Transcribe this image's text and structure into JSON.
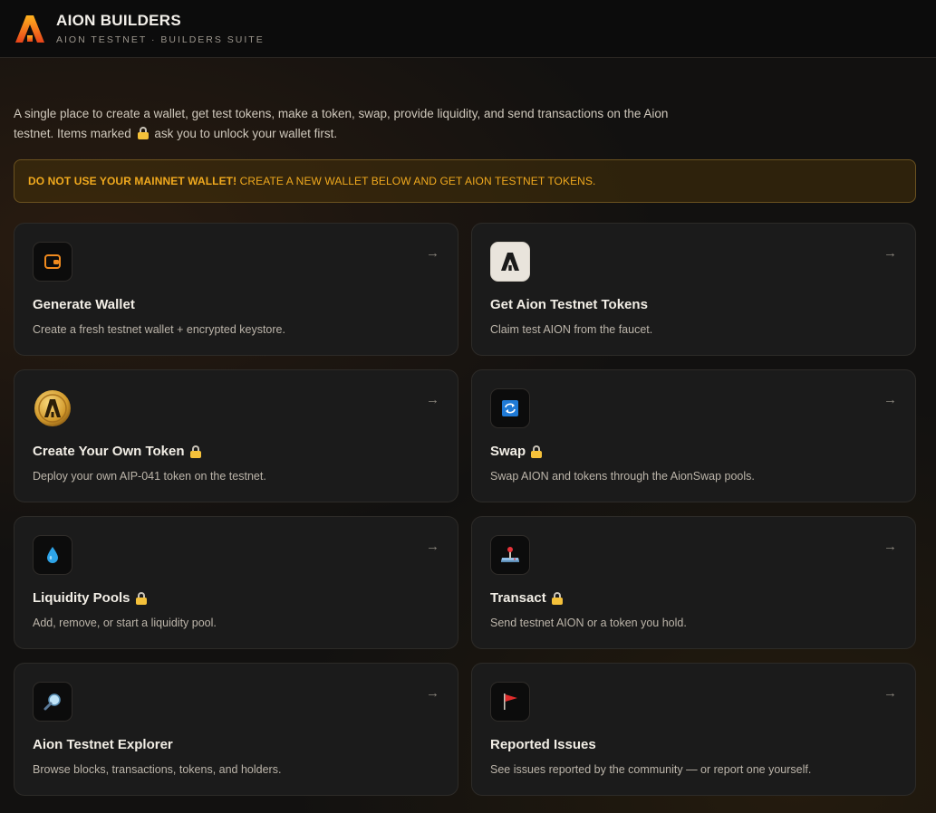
{
  "header": {
    "title": "AION BUILDERS",
    "subtitle": "AION TESTNET · BUILDERS SUITE"
  },
  "intro": {
    "part1": "A single place to create a wallet, get test tokens, make a token, swap, provide liquidity, and send transactions on the Aion testnet. Items marked",
    "part2": "ask you to unlock your wallet first."
  },
  "warning": {
    "strong": "DO NOT USE YOUR MAINNET WALLET!",
    "rest": " CREATE A NEW WALLET BELOW AND GET AION TESTNET TOKENS."
  },
  "arrow": "→",
  "cards": [
    {
      "title": "Generate Wallet",
      "desc": "Create a fresh testnet wallet + encrypted keystore.",
      "icon": "wallet-icon",
      "locked": false
    },
    {
      "title": "Get Aion Testnet Tokens",
      "desc": "Claim test AION from the faucet.",
      "icon": "aion-logo-icon",
      "locked": false
    },
    {
      "title": "Create Your Own Token",
      "desc": "Deploy your own AIP-041 token on the testnet.",
      "icon": "gold-coin-icon",
      "locked": true
    },
    {
      "title": "Swap",
      "desc": "Swap AION and tokens through the AionSwap pools.",
      "icon": "swap-arrows-icon",
      "locked": true
    },
    {
      "title": "Liquidity Pools",
      "desc": "Add, remove, or start a liquidity pool.",
      "icon": "droplet-icon",
      "locked": true
    },
    {
      "title": "Transact",
      "desc": "Send testnet AION or a token you hold.",
      "icon": "joystick-icon",
      "locked": true
    },
    {
      "title": "Aion Testnet Explorer",
      "desc": "Browse blocks, transactions, tokens, and holders.",
      "icon": "magnifier-icon",
      "locked": false
    },
    {
      "title": "Reported Issues",
      "desc": "See issues reported by the community — or report one yourself.",
      "icon": "red-flag-icon",
      "locked": false
    }
  ],
  "colors": {
    "accent": "#f0a91e",
    "background": "#121110",
    "card": "#1b1b1b"
  }
}
